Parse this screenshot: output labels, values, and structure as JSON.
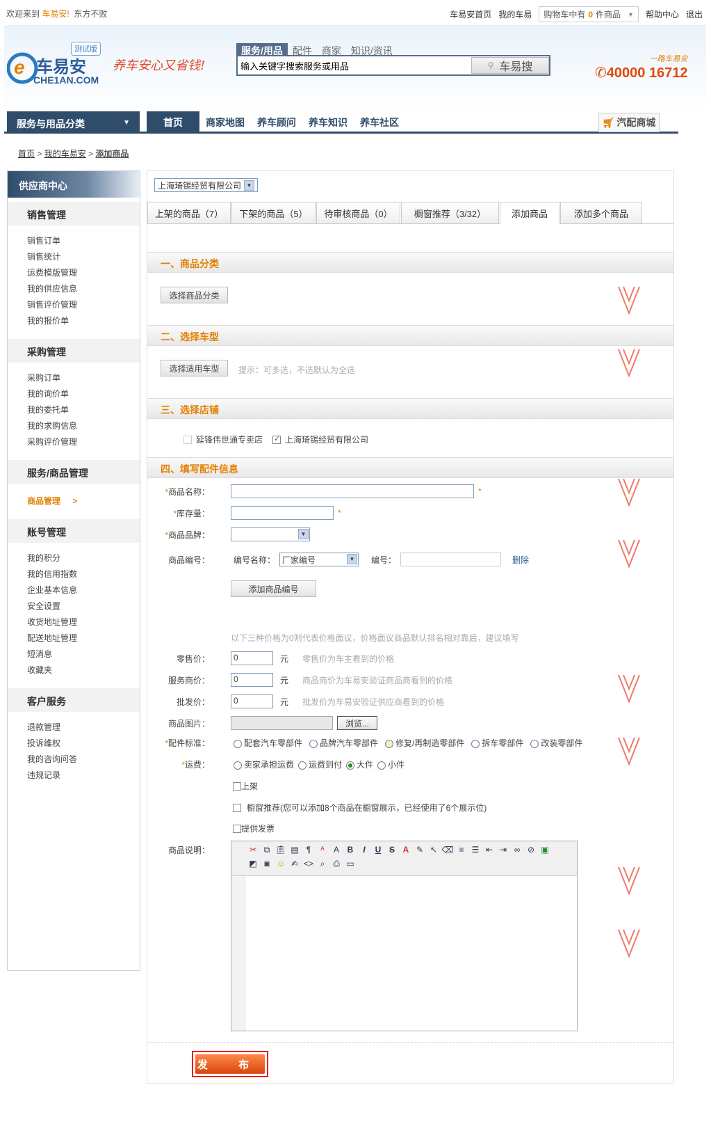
{
  "topbar": {
    "welcome": "欢迎来到",
    "site": "车易安!",
    "user": "东方不败",
    "links": [
      "车易安首页",
      "我的车易"
    ],
    "cart_prefix": "购物车中有",
    "cart_count": "0",
    "cart_suffix": "件商品",
    "help": "帮助中心",
    "logout": "退出"
  },
  "header": {
    "logo_text": "车易安",
    "logo_sub": "CHE1AN.COM",
    "beta": "测试版",
    "slogan": "养车安心又省钱!",
    "search_tabs": [
      "服务/用品",
      "配件",
      "商家",
      "知识/资讯"
    ],
    "search_placeholder": "输入关键字搜索服务或用品",
    "search_button": "车易搜",
    "hotline_small": "一路车易安",
    "hotline": "40000 16712"
  },
  "nav": {
    "category": "服务与用品分类",
    "items": [
      "首页",
      "商家地图",
      "养车顾问",
      "养车知识",
      "养车社区"
    ],
    "mall": "汽配商城"
  },
  "breadcrumb": [
    "首页",
    "我的车易安",
    "添加商品"
  ],
  "sidebar": {
    "title": "供应商中心",
    "sections": [
      {
        "title": "销售管理",
        "items": [
          "销售订单",
          "销售统计",
          "运费模版管理",
          "我的供应信息",
          "销售评价管理",
          "我的报价单"
        ]
      },
      {
        "title": "采购管理",
        "items": [
          "采购订单",
          "我的询价单",
          "我的委托单",
          "我的求购信息",
          "采购评价管理"
        ]
      },
      {
        "title": "服务/商品管理",
        "items": [
          "商品管理"
        ]
      },
      {
        "title": "账号管理",
        "items": [
          "我的积分",
          "我的信用指数",
          "企业基本信息",
          "安全设置",
          "收货地址管理",
          "配送地址管理",
          "短消息",
          "收藏夹"
        ]
      },
      {
        "title": "客户服务",
        "items": [
          "退款管理",
          "投诉维权",
          "我的咨询问答",
          "违规记录"
        ]
      }
    ]
  },
  "main": {
    "company": "上海琦锡经贸有限公司",
    "tabs": [
      "上架的商品（7）",
      "下架的商品（5）",
      "待审核商品（0）",
      "橱窗推荐（3/32）",
      "添加商品",
      "添加多个商品"
    ],
    "sec1": "一、商品分类",
    "sec1_btn": "选择商品分类",
    "sec2": "二、选择车型",
    "sec2_btn": "选择适用车型",
    "sec2_hint": "提示：可多选，不选默认为全选",
    "sec3": "三、选择店铺",
    "shops": [
      "延锋伟世通专卖店",
      "上海琦锡经贸有限公司"
    ],
    "sec4": "四、填写配件信息",
    "labels": {
      "name": "商品名称：",
      "stock": "库存量：",
      "brand": "商品品牌：",
      "code": "商品编号：",
      "code_name": "编号名称：",
      "code_name_value": "厂家编号",
      "code_no": "编号：",
      "delete": "删除",
      "add_code": "添加商品编号",
      "price_note": "以下三种价格为0则代表价格面议，价格面议商品默认排名相对靠后，建议填写",
      "retail": "零售价：",
      "service": "服务商价：",
      "wholesale": "批发价：",
      "yuan": "元",
      "retail_hint": "零售价为车主看到的价格",
      "service_hint": "商品商价为车易安验证商品商看到的价格",
      "wholesale_hint": "批发价为车易安验证供应商看到的价格",
      "image": "商品图片：",
      "browse": "浏览...",
      "standard": "配件标准：",
      "standards": [
        "配套汽车零部件",
        "品牌汽车零部件",
        "修复/再制造零部件",
        "拆车零部件",
        "改装零部件"
      ],
      "freight": "运费：",
      "freights": [
        "卖家承担运费",
        "运费到付",
        "大件",
        "小件"
      ],
      "onshelf": "上架",
      "window": "橱窗推荐(您可以添加8个商品在橱窗展示，已经使用了6个展示位)",
      "invoice": "提供发票",
      "desc": "商品说明："
    },
    "prices": {
      "retail": "0",
      "service": "0",
      "wholesale": "0"
    },
    "publish": "发 布"
  },
  "colors": {
    "navy": "#2f4d6b",
    "accent": "#e38100",
    "chevron": "#f07a6a"
  }
}
